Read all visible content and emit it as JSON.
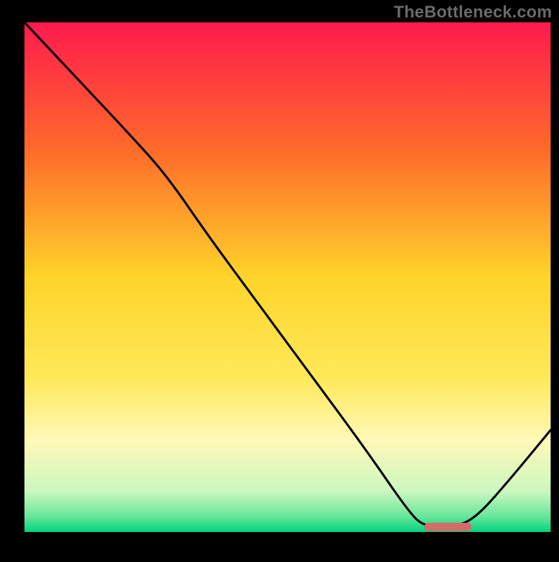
{
  "watermark": "TheBottleneck.com",
  "chart_data": {
    "type": "line",
    "title": "",
    "xlabel": "",
    "ylabel": "",
    "xlim": [
      0,
      100
    ],
    "ylim": [
      0,
      100
    ],
    "grid": false,
    "legend": false,
    "background": {
      "type": "vertical-gradient",
      "stops": [
        {
          "pos": 0.0,
          "color": "#ff1a4e"
        },
        {
          "pos": 0.25,
          "color": "#ff6a2a"
        },
        {
          "pos": 0.5,
          "color": "#ffd42a"
        },
        {
          "pos": 0.7,
          "color": "#ffe95a"
        },
        {
          "pos": 0.82,
          "color": "#fff9b8"
        },
        {
          "pos": 0.92,
          "color": "#ccf7c0"
        },
        {
          "pos": 0.97,
          "color": "#66e69a"
        },
        {
          "pos": 1.0,
          "color": "#00d37d"
        }
      ]
    },
    "curve": {
      "comment": "x in 0..100 left→right, y in 0..100 where 100 = top (best/red), 0 = bottom edge (optimal/green). Curve shows distance-from-optimal.",
      "x": [
        0,
        10,
        20,
        27,
        35,
        45,
        55,
        65,
        73,
        76,
        82,
        86,
        92,
        100
      ],
      "y": [
        100,
        89,
        78,
        70,
        58,
        44,
        30,
        16,
        4,
        1,
        1,
        3,
        10,
        20
      ]
    },
    "optimal_marker": {
      "type": "rounded-bar",
      "x_start": 76,
      "x_end": 85,
      "y": 1,
      "color": "#d46a6a"
    }
  }
}
